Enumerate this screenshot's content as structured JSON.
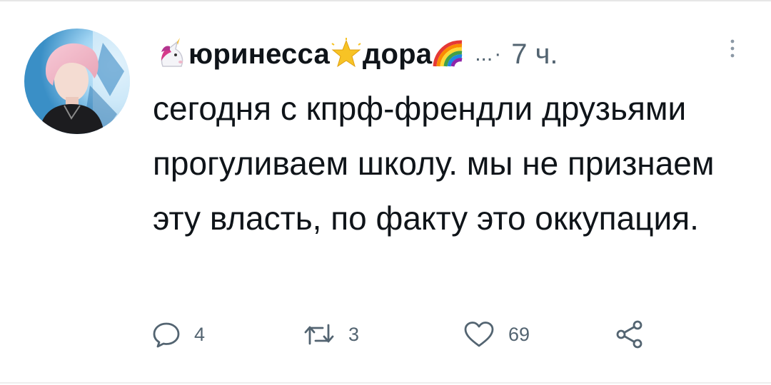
{
  "tweet": {
    "author": {
      "name_parts": [
        "юринесса",
        "дора"
      ],
      "name_emojis": [
        "unicorn",
        "glowing-star",
        "rainbow"
      ]
    },
    "handle_truncated": "...",
    "separator": "·",
    "timestamp": "7 ч.",
    "text": "сегодня с кпрф-френдли друзьями прогуливаем школу. мы не признаем эту власть, по факту это оккупация.",
    "stats": {
      "replies": "4",
      "retweets": "3",
      "likes": "69"
    }
  },
  "icons": {
    "more": "vertical-dots-icon",
    "reply": "speech-bubble-icon",
    "retweet": "retweet-arrows-icon",
    "like": "heart-icon",
    "share": "share-nodes-icon"
  },
  "colors": {
    "text": "#0f1419",
    "secondary": "#536471",
    "background": "#ffffff"
  }
}
